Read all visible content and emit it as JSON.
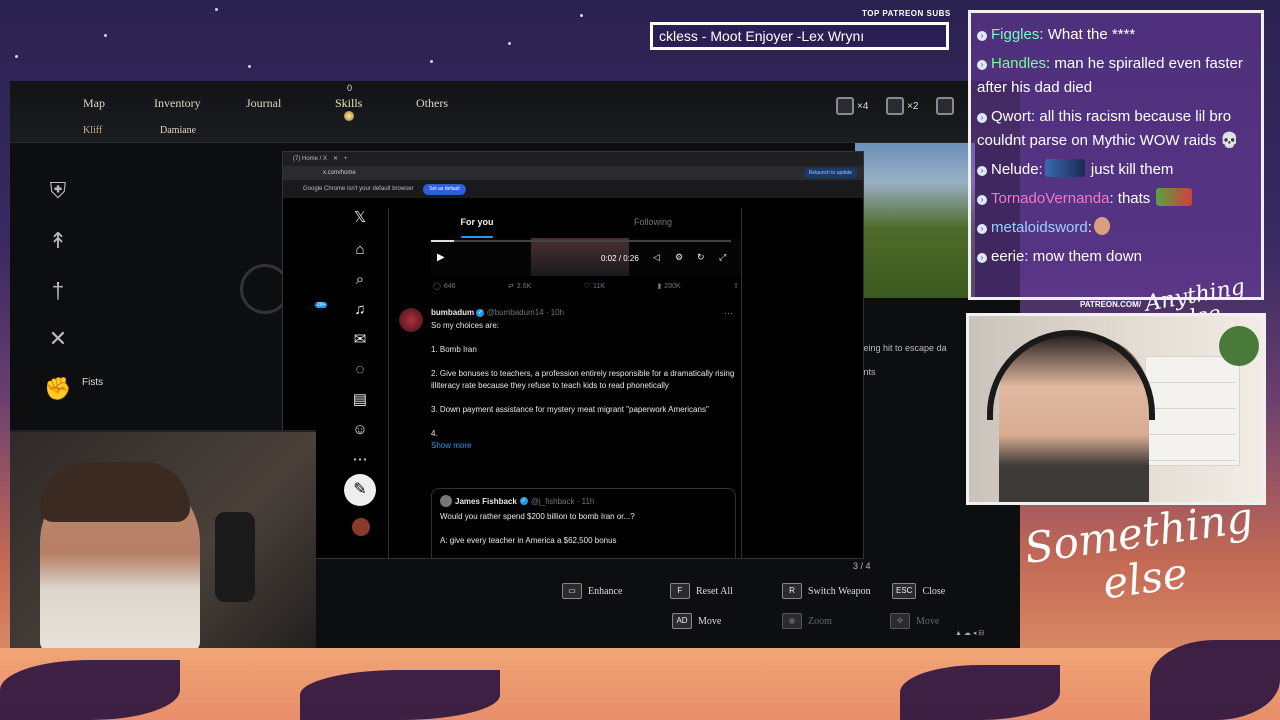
{
  "overlay": {
    "patreon_label": "TOP PATREON SUBS",
    "ticker_text": "ckless - Moot Enjoyer -Lex Wrynı",
    "patreon_url": "PATREON.COM/",
    "brand_script": "Something else",
    "brand_script_small": "Anything else"
  },
  "game": {
    "nav": [
      {
        "label": "Map"
      },
      {
        "label": "Inventory"
      },
      {
        "label": "Journal"
      },
      {
        "label": "Skills"
      },
      {
        "label": "Others"
      }
    ],
    "skills_badge": "0",
    "characters": [
      "Kliff",
      "Damiane"
    ],
    "resources": [
      {
        "count": "×4"
      },
      {
        "count": "×2"
      }
    ],
    "fists_label": "Fists",
    "side_text_1": "e being hit to escape da",
    "side_text_2": "ments",
    "page_count": "3 / 4",
    "controls": [
      {
        "key": "▭",
        "label": "Enhance"
      },
      {
        "key": "F",
        "label": "Reset All"
      },
      {
        "key": "R",
        "label": "Switch Weapon"
      },
      {
        "key": "ESC",
        "label": "Close"
      },
      {
        "key": "AD",
        "label": "Move"
      },
      {
        "key": "◉",
        "label": "Zoom"
      },
      {
        "key": "✥",
        "label": "Move"
      }
    ]
  },
  "browser": {
    "tab_title": "(7) Home / X",
    "url": "x.com/home",
    "update_btn": "Relaunch to update",
    "banner_text": "Google Chrome isn't your default browser",
    "set_default": "Set as default",
    "x": {
      "notif_badge": "20+",
      "tabs": [
        {
          "label": "For you"
        },
        {
          "label": "Following"
        }
      ],
      "video": {
        "time": "0:02 / 0:26",
        "progress": 0.077
      },
      "metrics": {
        "replies": "646",
        "reposts": "2.6K",
        "likes": "11K",
        "views": "200K"
      },
      "tweet": {
        "name": "bumbadum",
        "handle": "@bumbadum14 · 10h",
        "lines": [
          "So my choices are:",
          "1. Bomb Iran",
          "2. Give bonuses to teachers, a profession entirely responsible for a dramatically rising illiteracy rate because they refuse to teach kids to read phonetically",
          "3. Down payment assistance for mystery meat migrant \"paperwork Americans\"",
          "4."
        ],
        "show_more": "Show more"
      },
      "quote": {
        "name": "James Fishback",
        "handle": "@j_fishback · 11h",
        "lines": [
          "Would you rather spend $200 billion to bomb Iran or...?",
          "A: give every teacher in America a $62,500 bonus"
        ]
      }
    }
  },
  "chat": [
    {
      "user": "Figgles",
      "color": "#7ff5c8",
      "text": ": What the ****",
      "emote": ""
    },
    {
      "user": "Handles",
      "color": "#7ff5a0",
      "text": ": man he spiralled even faster after his dad died",
      "emote": ""
    },
    {
      "user": "Qwort",
      "color": "#ffffff",
      "text": ": all this racism because lil bro couldnt parse on Mythic WOW raids",
      "emote": "💀"
    },
    {
      "user": "Nelude",
      "color": "#ffffff",
      "text": " just kill them",
      "emote": "img"
    },
    {
      "user": "TornadoVernanda",
      "color": "#f07ac8",
      "text": ": thats",
      "emote": "img2"
    },
    {
      "user": "metaloidsword",
      "color": "#9ad0ff",
      "text": ":",
      "emote": "img3"
    },
    {
      "user": "eerie",
      "color": "#ffffff",
      "text": ": mow them down",
      "emote": ""
    }
  ]
}
